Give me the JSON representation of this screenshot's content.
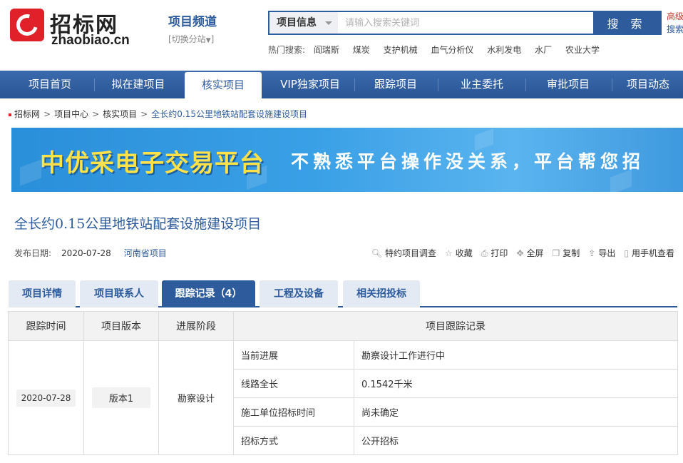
{
  "header": {
    "logo_cn": "招标网",
    "logo_en": "zhaobiao.cn",
    "channel_title": "项目频道",
    "channel_switch": "[切换分站",
    "search_category": "项目信息",
    "search_placeholder": "请输入搜索关键词",
    "search_button": "搜 索",
    "advanced_top": "高级",
    "advanced_bottom": "搜索",
    "hot_label": "热门搜索:",
    "hot_keywords": [
      "阎瑞斯",
      "煤炭",
      "支护机械",
      "血气分析仪",
      "水利发电",
      "水厂",
      "农业大学"
    ]
  },
  "nav": {
    "items": [
      "项目首页",
      "拟在建项目",
      "核实项目",
      "VIP独家项目",
      "跟踪项目",
      "业主委托",
      "审批项目",
      "项目动态"
    ],
    "active": "核实项目"
  },
  "breadcrumb": [
    "招标网",
    "项目中心",
    "核实项目",
    "全长约0.15公里地铁站配套设施建设项目"
  ],
  "banner": {
    "title": "中优采电子交易平台",
    "subtitle": "不熟悉平台操作没关系，平台帮您招"
  },
  "project": {
    "title": "全长约0.15公里地铁站配套设施建设项目",
    "date_label": "发布日期:",
    "date": "2020-07-28",
    "province": "河南省项目"
  },
  "tools": [
    {
      "icon": "magnifier-icon",
      "label": "特约项目调查"
    },
    {
      "icon": "star-icon",
      "label": "收藏"
    },
    {
      "icon": "printer-icon",
      "label": "打印"
    },
    {
      "icon": "fullscreen-icon",
      "label": "全屏"
    },
    {
      "icon": "copy-icon",
      "label": "复制"
    },
    {
      "icon": "export-icon",
      "label": "导出"
    },
    {
      "icon": "phone-icon",
      "label": "用手机查看"
    }
  ],
  "tabs": [
    "项目详情",
    "项目联系人",
    "跟踪记录（4）",
    "工程及设备",
    "相关招投标"
  ],
  "active_tab": "跟踪记录（4）",
  "table": {
    "headers": [
      "跟踪时间",
      "项目版本",
      "进展阶段",
      "项目跟踪记录"
    ],
    "time": "2020-07-28",
    "version": "版本1",
    "stage": "勘察设计",
    "records": [
      {
        "key": "当前进展",
        "value": "勘察设计工作进行中"
      },
      {
        "key": "线路全长",
        "value": "0.1542千米"
      },
      {
        "key": "施工单位招标时间",
        "value": "尚未确定"
      },
      {
        "key": "招标方式",
        "value": "公开招标"
      }
    ]
  },
  "colors": {
    "primary": "#2d5b9c",
    "logo_red": "#e12129",
    "banner_yellow": "#ffe14a"
  }
}
